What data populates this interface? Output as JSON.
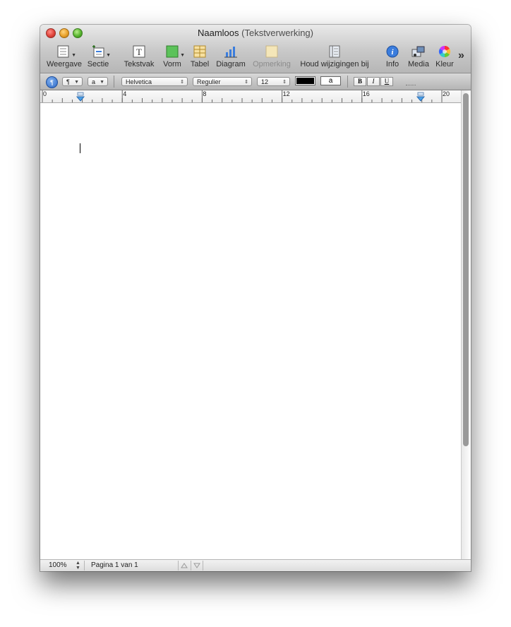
{
  "window": {
    "document_name": "Naamloos",
    "app_name": "(Tekstverwerking)"
  },
  "toolbar": {
    "items": [
      {
        "label": "Weergave",
        "icon": "view-icon",
        "dropdown": true
      },
      {
        "label": "Sectie",
        "icon": "section-icon",
        "dropdown": true
      },
      {
        "label": "Tekstvak",
        "icon": "textbox-icon"
      },
      {
        "label": "Vorm",
        "icon": "shape-icon",
        "dropdown": true
      },
      {
        "label": "Tabel",
        "icon": "table-icon"
      },
      {
        "label": "Diagram",
        "icon": "chart-icon"
      },
      {
        "label": "Opmerking",
        "icon": "comment-icon",
        "disabled": true
      },
      {
        "label": "Houd wijzigingen bij",
        "icon": "track-changes-icon"
      },
      {
        "label": "Info",
        "icon": "info-icon"
      },
      {
        "label": "Media",
        "icon": "media-icon"
      },
      {
        "label": "Kleur",
        "icon": "color-wheel-icon"
      }
    ],
    "more_glyph": "»"
  },
  "format_bar": {
    "paragraph_style": "¶",
    "character_style": "a",
    "font_family": "Helvetica",
    "font_style": "Regulier",
    "font_size": "12",
    "text_color": "#000000",
    "highlight_sample": "a",
    "bold": "B",
    "italic": "I",
    "underline": "U"
  },
  "ruler": {
    "labels": [
      "0",
      "4",
      "8",
      "12",
      "16",
      "20"
    ]
  },
  "status_bar": {
    "zoom": "100%",
    "page_info": "Pagina 1 van 1"
  },
  "colors": {
    "accent": "#3b7ddd",
    "marker": "#4aa0e8"
  }
}
